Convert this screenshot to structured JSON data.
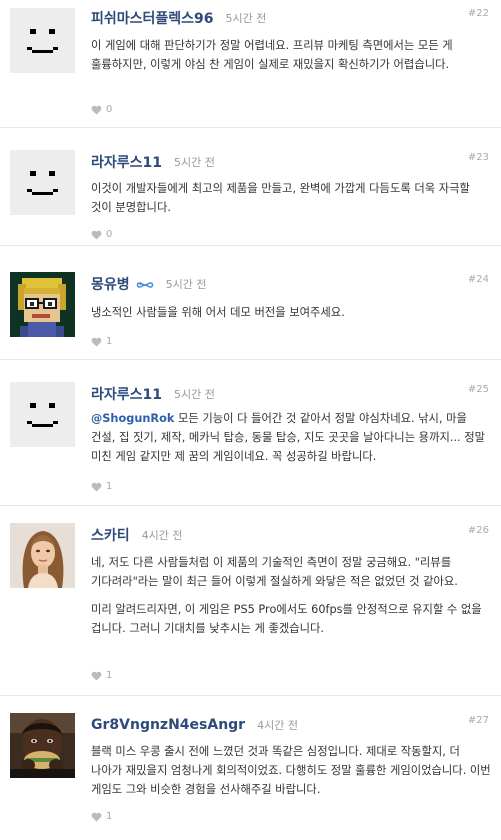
{
  "comments": [
    {
      "name": "피쉬마스터플렉스96",
      "time": "5시간 전",
      "number": "#22",
      "avatar": "default-smiley",
      "paragraphs": [
        "이 게임에 대해 판단하기가 정말 어렵네요. 프리뷰 마케팅 측면에서는 모든 게 훌륭하지만, 이렇게 야심 찬 게임이 실제로 재밌을지 확신하기가 어렵습니다."
      ],
      "likes": "0"
    },
    {
      "name": "라자루스11",
      "time": "5시간 전",
      "number": "#23",
      "avatar": "default-smiley",
      "paragraphs": [
        "이것이 개발자들에게 최고의 제품을 만들고, 완벽에 가깝게 다듬도록 더욱 자극할 것이 분명합니다."
      ],
      "likes": "0"
    },
    {
      "name": "몽유병",
      "time": "5시간 전",
      "number": "#24",
      "avatar": "pixel-character",
      "badge": "infinity-icon",
      "paragraphs": [
        "냉소적인 사람들을 위해 어서 데모 버전을 보여주세요."
      ],
      "likes": "1"
    },
    {
      "name": "라자루스11",
      "time": "5시간 전",
      "number": "#25",
      "avatar": "default-smiley",
      "mention": "@ShogunRok",
      "paragraphs": [
        " 모든 기능이 다 들어간 것 같아서 정말 야심차네요. 낚시, 마을 건설, 집 짓기, 제작, 메카닉 탑승, 동물 탑승, 지도 곳곳을 날아다니는 용까지... 정말 미친 게임 같지만 제 꿈의 게임이네요. 꼭 성공하길 바랍니다."
      ],
      "likes": "1"
    },
    {
      "name": "스카티",
      "time": "4시간 전",
      "number": "#26",
      "avatar": "woman-photo",
      "paragraphs": [
        "네, 저도 다른 사람들처럼 이 제품의 기술적인 측면이 정말 궁금해요. \"리뷰를 기다려라\"라는 말이 최근 들어 이렇게 절실하게 와닿은 적은 없었던 것 같아요.",
        "미리 알려드리자면, 이 게임은 PS5 Pro에서도 60fps를 안정적으로 유지할 수 없을 겁니다. 그러니 기대치를 낮추시는 게 좋겠습니다."
      ],
      "likes": "1"
    },
    {
      "name": "Gr8VngnzN4esAngr",
      "time": "4시간 전",
      "number": "#27",
      "avatar": "man-eating-photo",
      "paragraphs": [
        "블랙 미스 우콩 출시 전에 느꼈던 것과 똑같은 심정입니다. 제대로 작동할지, 더 나아가 재밌을지 엄청나게 회의적이었죠. 다행히도 정말 훌륭한 게임이었습니다. 이번 게임도 그와 비슷한 경험을 선사해주길 바랍니다."
      ],
      "likes": "1"
    }
  ],
  "colors": {
    "name": "#2c4a7a",
    "mention": "#2c5fa8",
    "muted": "#aaaaaa",
    "divider": "#e6e6e6"
  }
}
